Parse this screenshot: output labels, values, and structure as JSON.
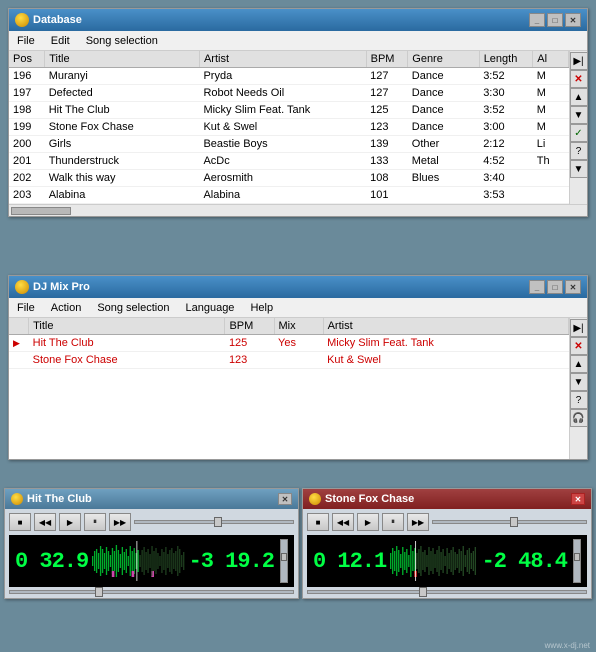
{
  "database_window": {
    "title": "Database",
    "menu": [
      "File",
      "Edit",
      "Song selection"
    ],
    "columns": [
      "Pos",
      "Title",
      "Artist",
      "BPM",
      "Genre",
      "Length",
      "Al"
    ],
    "rows": [
      {
        "pos": "196",
        "title": "Muranyi",
        "artist": "Pryda",
        "bpm": "127",
        "genre": "Dance",
        "length": "3:52",
        "al": "M"
      },
      {
        "pos": "197",
        "title": "Defected",
        "artist": "Robot Needs Oil",
        "bpm": "127",
        "genre": "Dance",
        "length": "3:30",
        "al": "M"
      },
      {
        "pos": "198",
        "title": "Hit The Club",
        "artist": "Micky Slim Feat. Tank",
        "bpm": "125",
        "genre": "Dance",
        "length": "3:52",
        "al": "M"
      },
      {
        "pos": "199",
        "title": "Stone Fox Chase",
        "artist": "Kut & Swel",
        "bpm": "123",
        "genre": "Dance",
        "length": "3:00",
        "al": "M"
      },
      {
        "pos": "200",
        "title": "Girls",
        "artist": "Beastie Boys",
        "bpm": "139",
        "genre": "Other",
        "length": "2:12",
        "al": "Li"
      },
      {
        "pos": "201",
        "title": "Thunderstruck",
        "artist": "AcDc",
        "bpm": "133",
        "genre": "Metal",
        "length": "4:52",
        "al": "Th"
      },
      {
        "pos": "202",
        "title": "Walk this way",
        "artist": "Aerosmith",
        "bpm": "108",
        "genre": "Blues",
        "length": "3:40",
        "al": ""
      },
      {
        "pos": "203",
        "title": "Alabina",
        "artist": "Alabina",
        "bpm": "101",
        "genre": "",
        "length": "3:53",
        "al": ""
      }
    ],
    "side_buttons": [
      "▶▶|",
      "✕",
      "▲",
      "▼",
      "✓",
      "?",
      "▼▼"
    ],
    "close_btn": "✕",
    "min_btn": "_",
    "max_btn": "□"
  },
  "djmix_window": {
    "title": "DJ Mix Pro",
    "menu": [
      "File",
      "Action",
      "Song selection",
      "Language",
      "Help"
    ],
    "columns": [
      "Title",
      "BPM",
      "Mix",
      "Artist"
    ],
    "rows": [
      {
        "title": "Hit The Club",
        "bpm": "125",
        "mix": "Yes",
        "artist": "Micky Slim Feat. Tank",
        "playing": true
      },
      {
        "title": "Stone Fox Chase",
        "bpm": "123",
        "mix": "",
        "artist": "Kut & Swel",
        "playing": false
      }
    ],
    "side_buttons": [
      "▶▶|",
      "✕",
      "▲",
      "▼",
      "?",
      "🎧"
    ],
    "close_btn": "✕",
    "min_btn": "_",
    "max_btn": "□"
  },
  "player1": {
    "title": "Hit The Club",
    "close_btn": "✕",
    "time_pos": "0 32.9",
    "time_neg": "-3 19.2",
    "transport_buttons": [
      "■",
      "◀◀",
      "▶",
      "⏸",
      "▶▶"
    ]
  },
  "player2": {
    "title": "Stone Fox Chase",
    "close_btn": "✕",
    "time_pos": "0 12.1",
    "time_neg": "-2 48.4",
    "transport_buttons": [
      "■",
      "◀◀",
      "▶",
      "⏸",
      "▶▶"
    ]
  },
  "colors": {
    "accent_blue": "#2a6aa0",
    "title_bar": "#4a90c8",
    "selected_row": "#316ac5",
    "waveform_green": "#00ff44",
    "time_display_bg": "#000000",
    "red_text": "#cc0000"
  }
}
